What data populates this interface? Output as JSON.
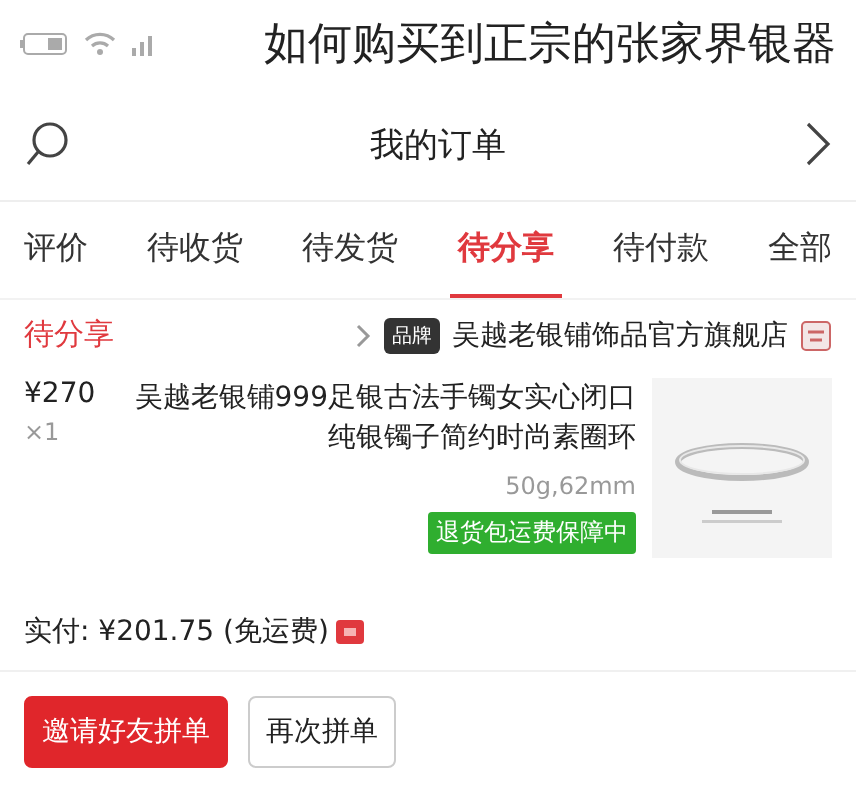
{
  "overlay_title": "如何购买到正宗的张家界银器",
  "nav": {
    "title": "我的订单"
  },
  "tabs": [
    {
      "label": "评价",
      "selected": false
    },
    {
      "label": "待收货",
      "selected": false
    },
    {
      "label": "待发货",
      "selected": false
    },
    {
      "label": "待分享",
      "selected": true
    },
    {
      "label": "待付款",
      "selected": false
    },
    {
      "label": "全部",
      "selected": false
    }
  ],
  "order": {
    "status": "待分享",
    "store": "吴越老银铺饰品官方旗舰店",
    "store_badge": "品牌",
    "product": {
      "title": "吴越老银铺999足银古法手镯女实心闭口纯银镯子简约时尚素圈环",
      "spec": "50g,62mm",
      "tag": "退货包运费保障中",
      "price": "¥270",
      "quantity": "×1"
    },
    "paid": "实付: ¥201.75 (免运费)",
    "buttons": [
      {
        "label": "邀请好友拼单",
        "primary": true
      },
      {
        "label": "再次拼单",
        "primary": false
      }
    ]
  }
}
